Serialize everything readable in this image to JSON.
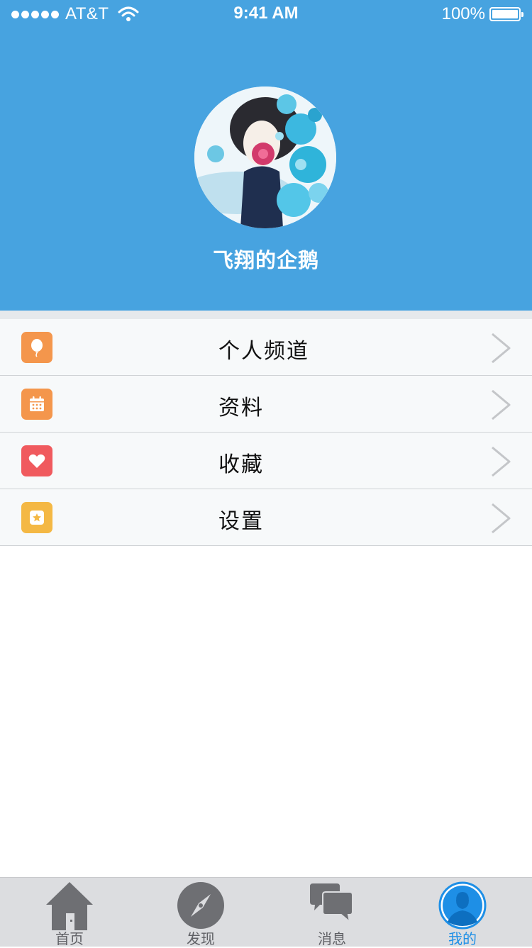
{
  "status_bar": {
    "carrier": "AT&T",
    "time": "9:41 AM",
    "battery": "100%"
  },
  "profile": {
    "username": "飞翔的企鹅",
    "avatar_icon": "avatar-illustration"
  },
  "menu": [
    {
      "label": "个人频道",
      "icon": "balloon-icon",
      "color": "#f4964c"
    },
    {
      "label": "资料",
      "icon": "calendar-icon",
      "color": "#f4964c"
    },
    {
      "label": "收藏",
      "icon": "heart-icon",
      "color": "#f05a5e"
    },
    {
      "label": "设置",
      "icon": "star-icon",
      "color": "#f4b844"
    }
  ],
  "tabs": [
    {
      "label": "首页",
      "icon": "home-icon"
    },
    {
      "label": "发现",
      "icon": "compass-icon"
    },
    {
      "label": "消息",
      "icon": "chat-icon"
    },
    {
      "label": "我的",
      "icon": "user-icon",
      "active": true
    }
  ],
  "colors": {
    "header": "#47a3e0",
    "active_tab": "#1e8fe6",
    "inactive_tab": "#6e6f73"
  }
}
